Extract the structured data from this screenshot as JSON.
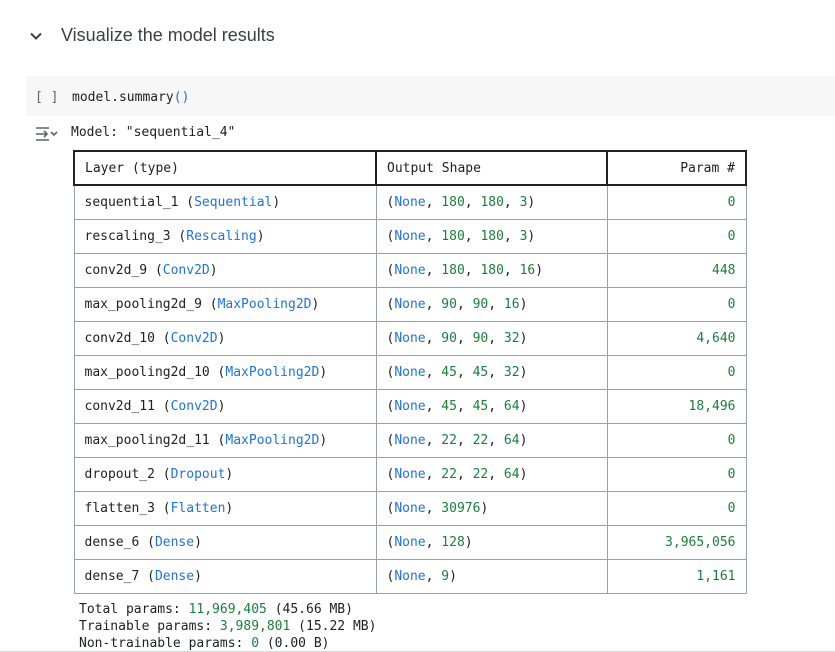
{
  "section": {
    "title": "Visualize the model results"
  },
  "cell": {
    "run_indicator": "[ ]",
    "code_name": "model.summary",
    "code_parens": "()"
  },
  "output": {
    "model_label": "Model: \"sequential_4\"",
    "headers": [
      "Layer (type)",
      "Output Shape",
      "Param #"
    ],
    "rows": [
      {
        "name": "sequential_1",
        "type": "Sequential",
        "dims": [
          "180",
          "180",
          "3"
        ],
        "params": "0"
      },
      {
        "name": "rescaling_3",
        "type": "Rescaling",
        "dims": [
          "180",
          "180",
          "3"
        ],
        "params": "0"
      },
      {
        "name": "conv2d_9",
        "type": "Conv2D",
        "dims": [
          "180",
          "180",
          "16"
        ],
        "params": "448"
      },
      {
        "name": "max_pooling2d_9",
        "type": "MaxPooling2D",
        "dims": [
          "90",
          "90",
          "16"
        ],
        "params": "0"
      },
      {
        "name": "conv2d_10",
        "type": "Conv2D",
        "dims": [
          "90",
          "90",
          "32"
        ],
        "params": "4,640"
      },
      {
        "name": "max_pooling2d_10",
        "type": "MaxPooling2D",
        "dims": [
          "45",
          "45",
          "32"
        ],
        "params": "0"
      },
      {
        "name": "conv2d_11",
        "type": "Conv2D",
        "dims": [
          "45",
          "45",
          "64"
        ],
        "params": "18,496"
      },
      {
        "name": "max_pooling2d_11",
        "type": "MaxPooling2D",
        "dims": [
          "22",
          "22",
          "64"
        ],
        "params": "0"
      },
      {
        "name": "dropout_2",
        "type": "Dropout",
        "dims": [
          "22",
          "22",
          "64"
        ],
        "params": "0"
      },
      {
        "name": "flatten_3",
        "type": "Flatten",
        "dims": [
          "30976"
        ],
        "params": "0"
      },
      {
        "name": "dense_6",
        "type": "Dense",
        "dims": [
          "128"
        ],
        "params": "3,965,056"
      },
      {
        "name": "dense_7",
        "type": "Dense",
        "dims": [
          "9"
        ],
        "params": "1,161"
      }
    ],
    "none_token": "None",
    "totals": [
      {
        "label": "Total params:",
        "value": "11,969,405",
        "size": "(45.66 MB)"
      },
      {
        "label": "Trainable params:",
        "value": "3,989,801",
        "size": "(15.22 MB)"
      },
      {
        "label": "Non-trainable params:",
        "value": "0",
        "size": "(0.00 B)"
      }
    ]
  },
  "colors": {
    "keyword": "#1a73e8",
    "number": "#188038",
    "text": "#202124",
    "cell_bg": "#f7f7f7"
  },
  "icons": [
    "chevron-down-icon",
    "output-toggle-icon"
  ]
}
